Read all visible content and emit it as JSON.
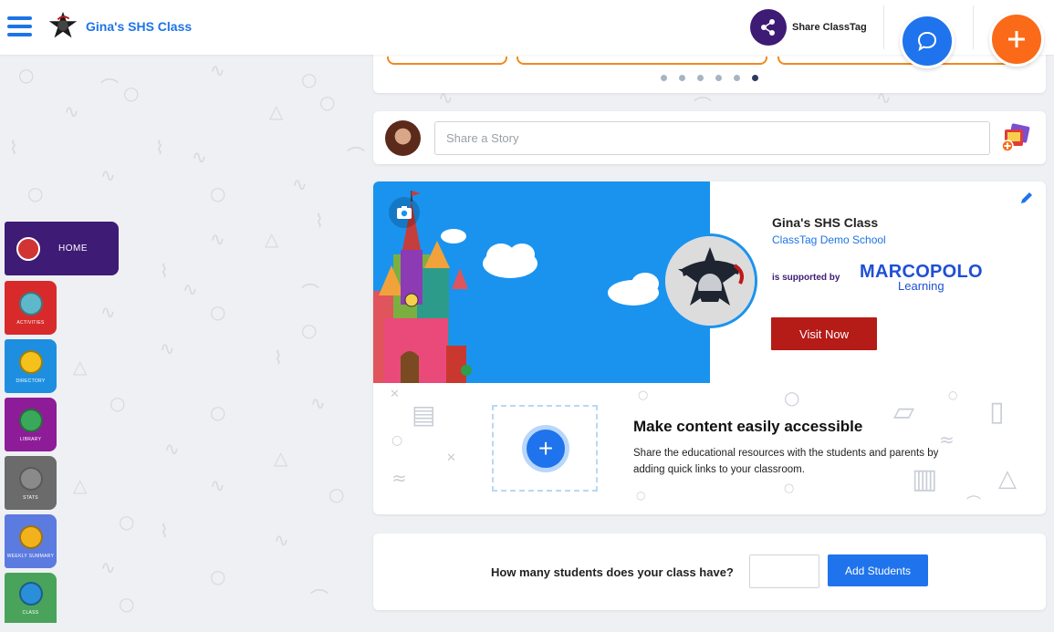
{
  "header": {
    "class_title": "Gina's SHS Class",
    "share_label": "Share ClassTag"
  },
  "sidenav": {
    "items": [
      {
        "label": "HOME",
        "color": "#3e1b75",
        "icon": "home-icon"
      },
      {
        "label": "ACTIVITIES",
        "color": "#d82a2a",
        "icon": "activities-icon"
      },
      {
        "label": "DIRECTORY",
        "color": "#1e8fe0",
        "icon": "directory-icon"
      },
      {
        "label": "LIBRARY",
        "color": "#8e1c99",
        "icon": "library-icon"
      },
      {
        "label": "STATS",
        "color": "#6b6b6b",
        "icon": "stats-icon"
      },
      {
        "label": "WEEKLY SUMMARY",
        "color": "#5c7be0",
        "icon": "weekly-summary-icon"
      },
      {
        "label": "CLASS",
        "color": "#4aa35a",
        "icon": "class-icon"
      }
    ]
  },
  "carousel": {
    "dots": 6,
    "active_index": 5
  },
  "story": {
    "placeholder": "Share a Story"
  },
  "class_card": {
    "title": "Gina's SHS Class",
    "school": "ClassTag Demo School",
    "supported_by": "is supported by",
    "sponsor_line1": "MARCOPOLO",
    "sponsor_line2": "Learning",
    "visit_label": "Visit Now"
  },
  "quick_links": {
    "title": "Make content easily accessible",
    "description": "Share the educational resources with the students and parents by adding quick links to your classroom.",
    "add_symbol": "+"
  },
  "students": {
    "question": "How many students does your class have?",
    "input_value": "",
    "button_label": "Add Students"
  },
  "colors": {
    "brand_blue": "#1f73ec",
    "brand_purple": "#3e1b75",
    "accent_orange": "#fb6a18",
    "visit_red": "#b51b17",
    "banner_sky": "#1a93ef"
  }
}
